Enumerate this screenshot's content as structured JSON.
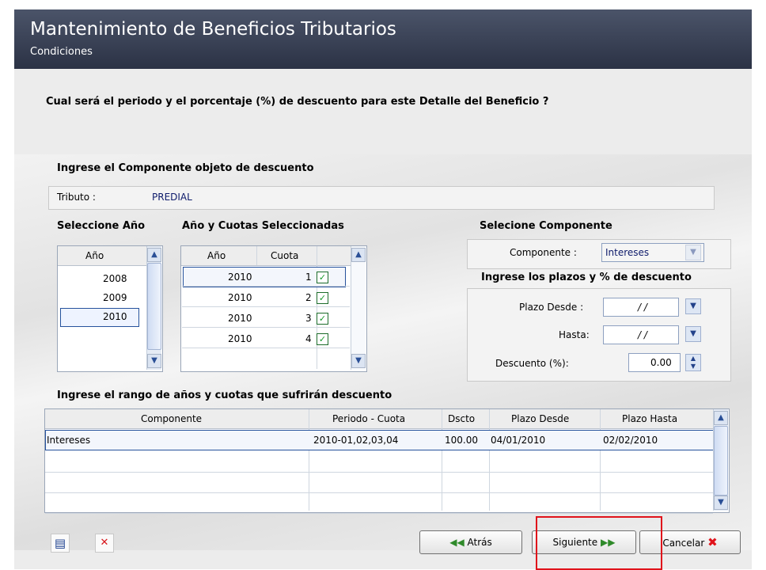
{
  "header": {
    "title": "Mantenimiento de Beneficios Tributarios",
    "subtitle": "Condiciones"
  },
  "question": "Cual será el periodo y el porcentaje (%) de descuento para este Detalle del Beneficio ?",
  "componente_section": {
    "heading": "Ingrese el Componente objeto de descuento",
    "tributo_label": "Tributo :",
    "tributo_value": "PREDIAL"
  },
  "seleccione_anio": {
    "heading": "Seleccione Año",
    "col": "Año",
    "years": [
      "2008",
      "2009",
      "2010"
    ],
    "selected": "2010"
  },
  "anio_cuotas": {
    "heading": "Año y Cuotas Seleccionadas",
    "col_anio": "Año",
    "col_cuota": "Cuota",
    "rows": [
      {
        "anio": "2010",
        "cuota": "1",
        "checked": true
      },
      {
        "anio": "2010",
        "cuota": "2",
        "checked": true
      },
      {
        "anio": "2010",
        "cuota": "3",
        "checked": true
      },
      {
        "anio": "2010",
        "cuota": "4",
        "checked": true
      }
    ]
  },
  "componente_select": {
    "heading": "Selecione Componente",
    "label": "Componente :",
    "value": "Intereses"
  },
  "plazos": {
    "heading": "Ingrese los plazos y % de descuento",
    "desde_label": "Plazo Desde :",
    "desde_value": "/ /",
    "hasta_label": "Hasta:",
    "hasta_value": "/ /",
    "descuento_label": "Descuento (%):",
    "descuento_value": "0.00"
  },
  "rango": {
    "heading": "Ingrese el rango de años y cuotas que sufrirán descuento",
    "columns": [
      "Componente",
      "Periodo - Cuota",
      "Dscto",
      "Plazo Desde",
      "Plazo Hasta"
    ],
    "rows": [
      [
        "Intereses",
        "2010-01,02,03,04",
        "100.00",
        "04/01/2010",
        "02/02/2010"
      ]
    ]
  },
  "buttons": {
    "atras": "Atrás",
    "siguiente": "Siguiente",
    "cancelar": "Cancelar"
  },
  "icons": {
    "scroll_up": "chevron-up-icon",
    "scroll_down": "chevron-down-icon",
    "copy": "document-list-icon",
    "delete": "delete-document-icon"
  },
  "colors": {
    "header": "#2f364a",
    "accent": "#26529c",
    "highlight": "#e0131b"
  }
}
